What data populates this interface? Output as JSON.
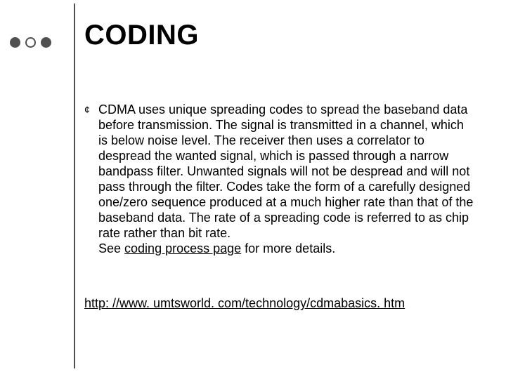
{
  "title": "CODING",
  "bullet": {
    "glyph": "¢",
    "text_main": "CDMA uses unique spreading codes to spread the baseband data before transmission. The signal is transmitted in a channel, which is below noise level. The receiver then uses a correlator to despread the wanted signal, which is passed through a narrow bandpass filter. Unwanted signals will not be despread and will not pass through the filter. Codes take the form of a carefully designed one/zero sequence produced at a much higher rate than that of the baseband data. The rate of a spreading code is referred to as chip rate rather than bit rate.",
    "see_prefix": "See ",
    "see_link": "coding process page",
    "see_suffix": " for more details."
  },
  "url": "http: //www. umtsworld. com/technology/cdmabasics. htm"
}
